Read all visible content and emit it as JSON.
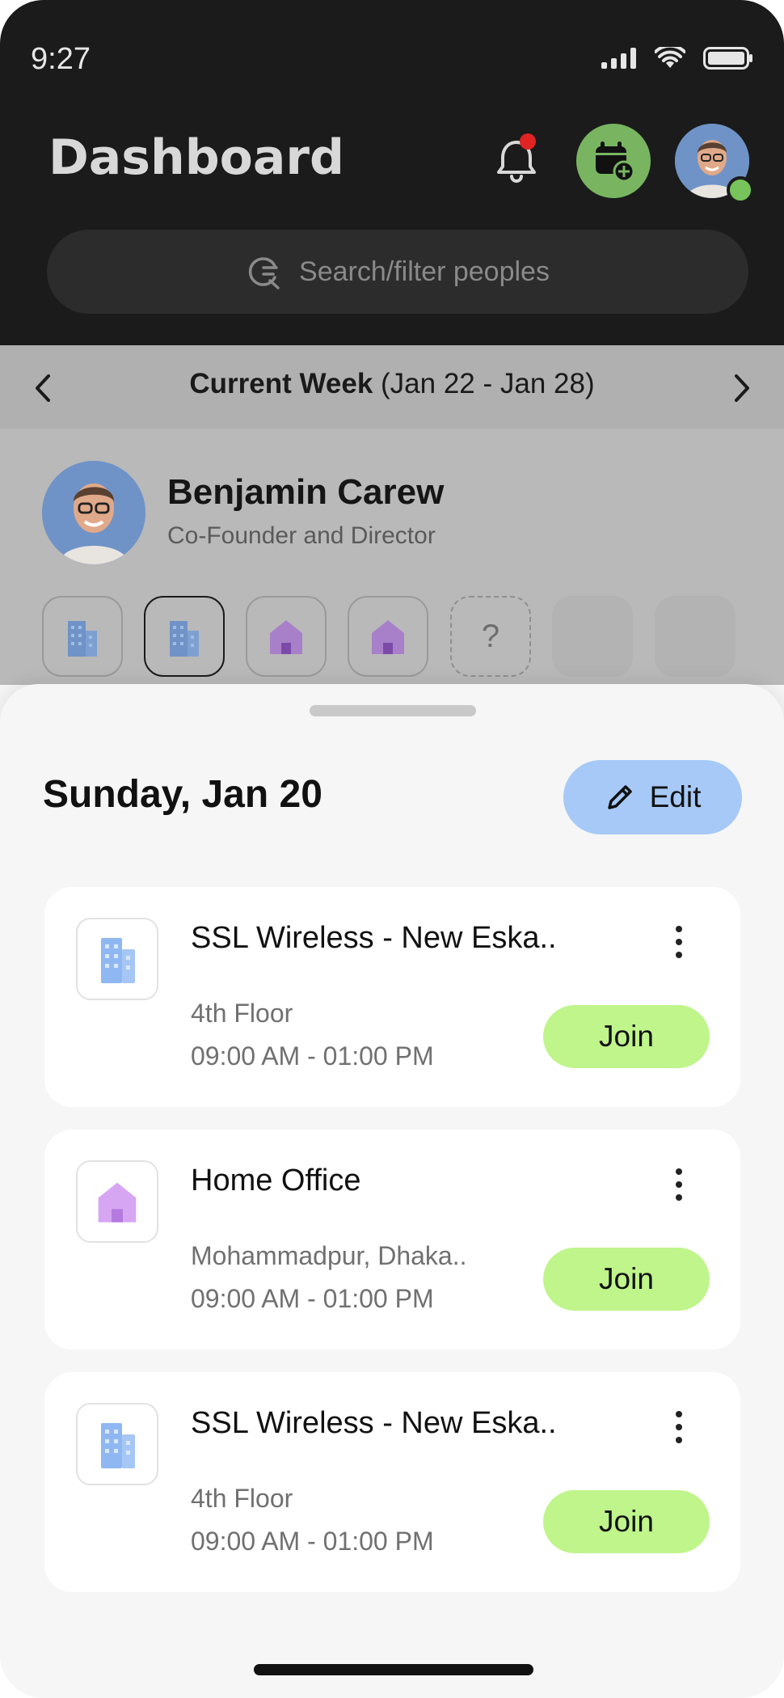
{
  "status_bar": {
    "time": "9:27"
  },
  "header": {
    "title": "Dashboard",
    "search_placeholder": "Search/filter peoples"
  },
  "week": {
    "label_bold": "Current Week",
    "label_range": "(Jan 22 - Jan 28)"
  },
  "person": {
    "name": "Benjamin Carew",
    "role": "Co-Founder and Director"
  },
  "location_chips": [
    {
      "icon": "building-icon",
      "selected": false
    },
    {
      "icon": "building-icon",
      "selected": true
    },
    {
      "icon": "home-icon",
      "selected": false
    },
    {
      "icon": "home-icon",
      "selected": false
    },
    {
      "icon": "unknown",
      "label": "?"
    },
    {
      "icon": "empty"
    },
    {
      "icon": "empty"
    }
  ],
  "sheet": {
    "day_title": "Sunday, Jan 20",
    "edit_label": "Edit",
    "bookings": [
      {
        "icon": "building-icon",
        "title": "SSL Wireless - New Eska..",
        "subtitle": "4th Floor",
        "time": "09:00 AM - 01:00 PM",
        "join_label": "Join"
      },
      {
        "icon": "home-icon",
        "title": "Home Office",
        "subtitle": "Mohammadpur, Dhaka..",
        "time": "09:00 AM - 01:00 PM",
        "join_label": "Join"
      },
      {
        "icon": "building-icon",
        "title": "SSL Wireless - New Eska..",
        "subtitle": "4th Floor",
        "time": "09:00 AM - 01:00 PM",
        "join_label": "Join"
      }
    ]
  },
  "colors": {
    "dark_header": "#1b1b1b",
    "calendar_button": "#79b560",
    "online_dot": "#76c45b",
    "notification_dot": "#e02424",
    "edit_button": "#a6c9f7",
    "join_button": "#bff58b",
    "building_icon": "#8fb8f2",
    "home_icon": "#d6a6f2"
  }
}
